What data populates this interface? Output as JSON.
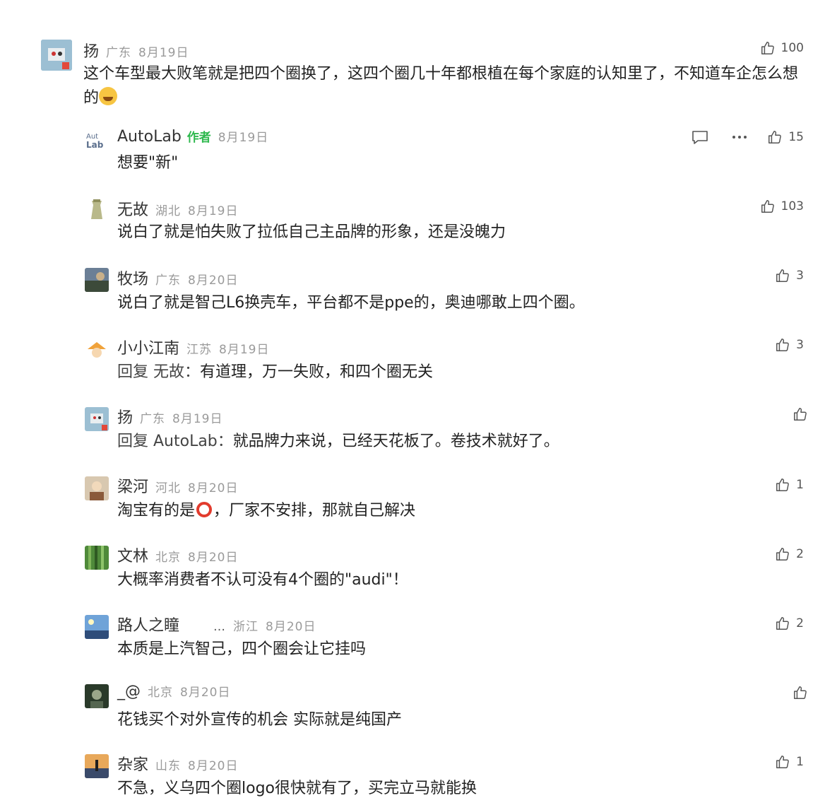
{
  "comments": [
    {
      "user": "扬",
      "region": "广东",
      "date": "8月19日",
      "likes": "100",
      "text": "这个车型最大败笔就是把四个圈换了，这四个圈几十年都根植在每个家庭的认知里了，不知道车企怎么想的"
    },
    {
      "user": "AutoLab",
      "author_tag": "作者",
      "date": "8月19日",
      "likes": "15",
      "text": "想要\"新\""
    },
    {
      "user": "无故",
      "region": "湖北",
      "date": "8月19日",
      "likes": "103",
      "text": "说白了就是怕失败了拉低自己主品牌的形象，还是没魄力"
    },
    {
      "user": "牧场",
      "region": "广东",
      "date": "8月20日",
      "likes": "3",
      "text": "说白了就是智己L6换壳车，平台都不是ppe的，奥迪哪敢上四个圈。"
    },
    {
      "user": "小小江南",
      "region": "江苏",
      "date": "8月19日",
      "likes": "3",
      "reply_prefix": "回复 无故：",
      "text": "有道理，万一失败，和四个圈无关"
    },
    {
      "user": "扬",
      "region": "广东",
      "date": "8月19日",
      "likes": "",
      "reply_prefix": "回复 AutoLab：",
      "text": "就品牌力来说，已经天花板了。卷技术就好了。"
    },
    {
      "user": "梁河",
      "region": "河北",
      "date": "8月20日",
      "likes": "1",
      "text_before": "淘宝有的是",
      "text_after": "，厂家不安排，那就自己解决"
    },
    {
      "user": "文林",
      "region": "北京",
      "date": "8月20日",
      "likes": "2",
      "text": "大概率消费者不认可没有4个圈的\"audi\"！"
    },
    {
      "user": "路人之瞳",
      "ellipsis": "…",
      "region": "浙江",
      "date": "8月20日",
      "likes": "2",
      "text": "本质是上汽智己，四个圈会让它挂吗"
    },
    {
      "user": "_@",
      "region": "北京",
      "date": "8月20日",
      "likes": "",
      "text": "花钱买个对外宣传的机会 实际就是纯国产"
    },
    {
      "user": "杂家",
      "region": "山东",
      "date": "8月20日",
      "likes": "1",
      "text": "不急，义乌四个圈logo很快就有了，买完立马就能换"
    }
  ]
}
